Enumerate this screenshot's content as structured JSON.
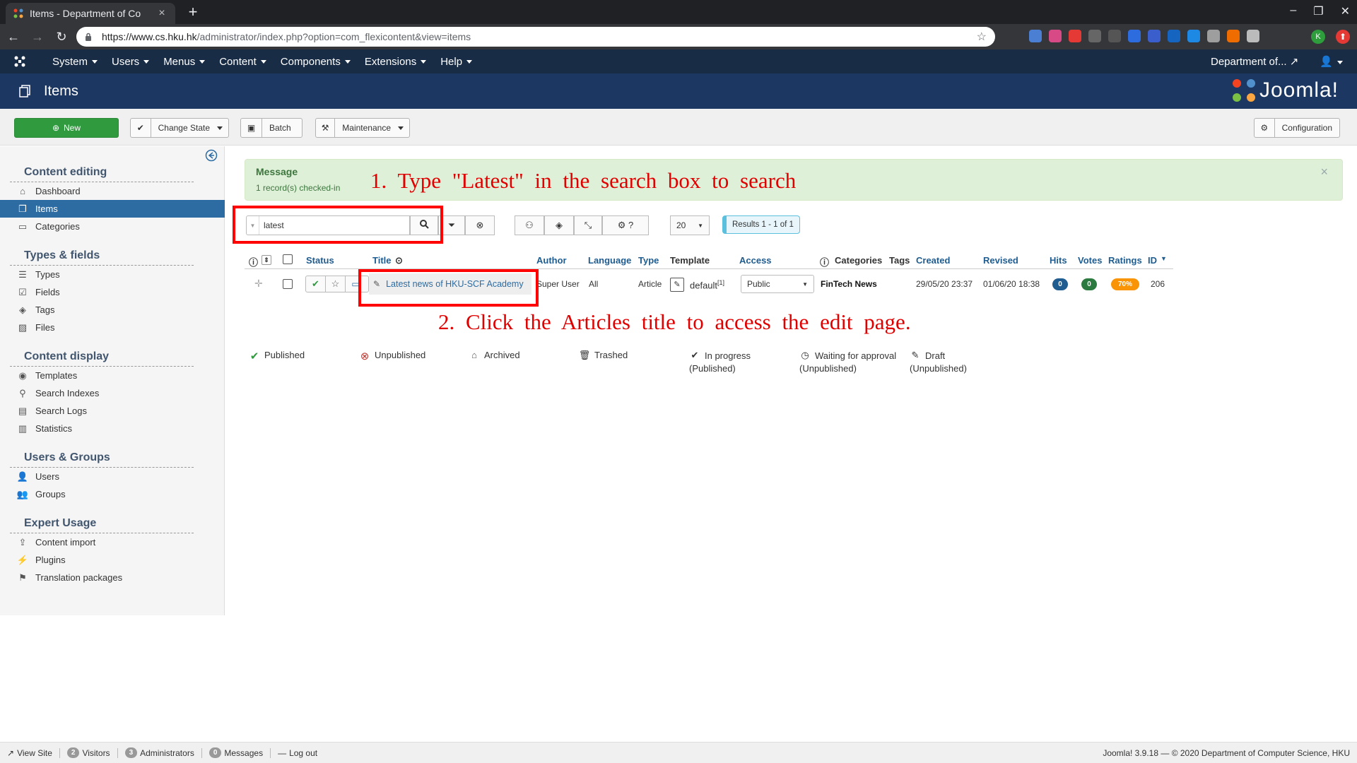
{
  "browser": {
    "tab_title": "Items - Department of Co",
    "url_host": "https://www.cs.hku.hk",
    "url_path": "/administrator/index.php?option=com_flexicontent&view=items"
  },
  "topnav": {
    "menus": [
      "System",
      "Users",
      "Menus",
      "Content",
      "Components",
      "Extensions",
      "Help"
    ],
    "site_link": "Department of..."
  },
  "header": {
    "title": "Items",
    "brand": "Joomla!"
  },
  "toolbar": {
    "new_label": "New",
    "change_state_label": "Change State",
    "batch_label": "Batch",
    "maintenance_label": "Maintenance",
    "configuration_label": "Configuration"
  },
  "sidebar": {
    "groups": [
      {
        "title": "Content editing",
        "items": [
          "Dashboard",
          "Items",
          "Categories"
        ]
      },
      {
        "title": "Types & fields",
        "items": [
          "Types",
          "Fields",
          "Tags",
          "Files"
        ]
      },
      {
        "title": "Content display",
        "items": [
          "Templates",
          "Search Indexes",
          "Search Logs",
          "Statistics"
        ]
      },
      {
        "title": "Users & Groups",
        "items": [
          "Users",
          "Groups"
        ]
      },
      {
        "title": "Expert Usage",
        "items": [
          "Content import",
          "Plugins",
          "Translation packages"
        ]
      }
    ]
  },
  "message": {
    "heading": "Message",
    "text": "1 record(s) checked-in"
  },
  "annotations": {
    "step1": "1. Type \"Latest\" in the search box to search",
    "step2": "2. Click the Articles title to access the edit page."
  },
  "search": {
    "value": "latest",
    "limit": "20",
    "results": "Results 1 - 1 of 1"
  },
  "table": {
    "columns": {
      "status": "Status",
      "title": "Title",
      "author": "Author",
      "language": "Language",
      "type": "Type",
      "template": "Template",
      "access": "Access",
      "categories": "Categories",
      "tags": "Tags",
      "created": "Created",
      "revised": "Revised",
      "hits": "Hits",
      "votes": "Votes",
      "ratings": "Ratings",
      "id": "ID"
    },
    "row": {
      "title": "Latest news of HKU-SCF Academy",
      "author": "Super User",
      "language": "All",
      "type": "Article",
      "template": "default",
      "template_sup": "[1]",
      "access": "Public",
      "category": "FinTech News",
      "created": "29/05/20 23:37",
      "revised": "01/06/20 18:38",
      "hits": "0",
      "votes": "0",
      "rating": "70%",
      "id": "206"
    }
  },
  "legend": {
    "published": "Published",
    "unpublished": "Unpublished",
    "archived": "Archived",
    "trashed": "Trashed",
    "in_progress": "In progress",
    "in_progress_sub": "(Published)",
    "waiting": "Waiting for approval",
    "waiting_sub": "(Unpublished)",
    "draft": "Draft",
    "draft_sub": "(Unpublished)"
  },
  "footer": {
    "view_site": "View Site",
    "visitors_count": "2",
    "visitors": "Visitors",
    "admins_count": "3",
    "admins": "Administrators",
    "messages_count": "0",
    "messages": "Messages",
    "logout": "Log out",
    "copyright": "Joomla! 3.9.18 — © 2020 Department of Computer Science, HKU"
  },
  "colors": {
    "nav": "#182c46",
    "header": "#1b3762",
    "accent": "#2d6ca2",
    "new_button": "#2f9a3e",
    "annotation": "#e00000"
  }
}
